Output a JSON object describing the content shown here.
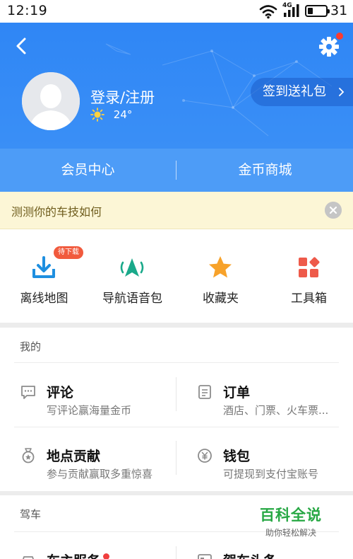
{
  "status_bar": {
    "time": "12:19",
    "network_type": "4G",
    "battery_level": "31",
    "battery_fraction": 0.31
  },
  "header": {
    "login_text": "登录/注册",
    "weather_icon": "sun-icon",
    "temperature": "24°",
    "signin_label": "签到送礼包",
    "back_icon": "chevron-left-icon",
    "settings_icon": "gear-icon",
    "bg_color": "#2f86f5"
  },
  "member_bar": {
    "left_label": "会员中心",
    "right_label": "金币商城"
  },
  "banner": {
    "text": "测测你的车技如何",
    "bg_color": "#fcf6d6"
  },
  "tools": [
    {
      "label": "离线地图",
      "icon": "download-icon",
      "badge": "待下载"
    },
    {
      "label": "导航语音包",
      "icon": "navigation-voice-icon"
    },
    {
      "label": "收藏夹",
      "icon": "star-icon"
    },
    {
      "label": "工具箱",
      "icon": "toolbox-icon"
    }
  ],
  "mine": {
    "title": "我的",
    "items": [
      {
        "title": "评论",
        "subtitle": "写评论赢海量金币",
        "icon": "comment-icon"
      },
      {
        "title": "订单",
        "subtitle": "酒店、门票、火车票...",
        "icon": "order-icon"
      },
      {
        "title": "地点贡献",
        "subtitle": "参与贡献赢取多重惊喜",
        "icon": "medal-icon"
      },
      {
        "title": "钱包",
        "subtitle": "可提现到支付宝账号",
        "icon": "wallet-icon"
      }
    ]
  },
  "drive": {
    "title": "驾车",
    "items": [
      {
        "title": "车主服务",
        "icon": "car-icon"
      },
      {
        "title": "驾车头条",
        "icon": "news-icon"
      }
    ]
  },
  "watermark": {
    "title": "百科全说",
    "subtitle": "助你轻松解决"
  }
}
